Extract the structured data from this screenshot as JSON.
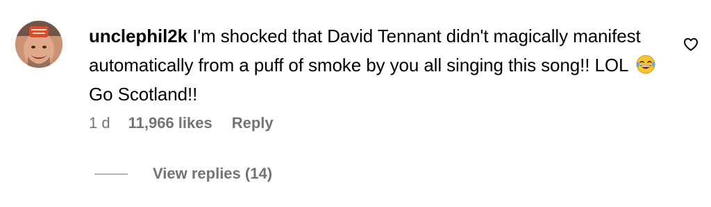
{
  "comment": {
    "avatar_icon": "user-avatar-photo",
    "username": "unclephil2k",
    "text_before_emoji": "I'm shocked that David Tennant didn't magically manifest automatically from a puff of smoke by you all singing this song!! LOL",
    "emoji_icon": "face-with-tears-of-joy-emoji",
    "text_after_emoji": "Go Scotland!!",
    "like_icon": "heart-outline-icon",
    "time_ago": "1 d",
    "likes": "11,966 likes",
    "reply_label": "Reply",
    "view_replies_label": "View replies (14)"
  },
  "colors": {
    "text": "#000000",
    "secondary_text": "#737373",
    "background": "#ffffff"
  }
}
